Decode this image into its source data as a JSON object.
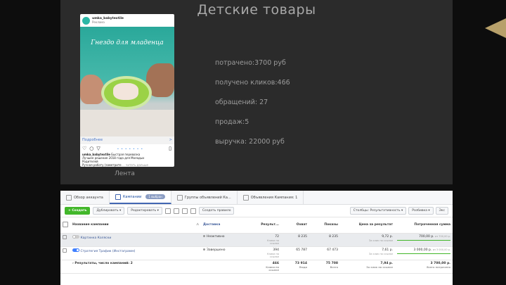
{
  "slide": {
    "title": "Детские товары",
    "caption": "Лента",
    "stats": [
      "потрачено:3700 руб",
      "получено кликов:466",
      "обращений: 27",
      "продаж:5",
      "выручка: 22000 руб"
    ]
  },
  "post": {
    "username": "umka_babytextile",
    "sponsored": "Реклама",
    "banner_text": "Гнездо для младенца",
    "more_label": "Подробнее",
    "more_arrow": ">",
    "dots": "• • • • • • •",
    "caption_user": "umka_babytextile",
    "caption_text": "Быстрая перевозка",
    "caption_line2": "Лучшее решение 2018 года для Молодых",
    "caption_line3": "Родителей",
    "caption_line4": "Ручная работу (заметрите",
    "caption_more": "... читать дальше",
    "icons": {
      "like": "heart-icon",
      "comment": "comment-icon",
      "share": "share-icon",
      "save": "bookmark-icon"
    }
  },
  "ads": {
    "tabs": [
      {
        "label": "Обзор аккаунта",
        "icon": "grid-icon"
      },
      {
        "label": "Кампании",
        "icon": "folder-icon",
        "badge": "1 выбран"
      },
      {
        "label": "Группы объявлений Ка...",
        "icon": "layers-icon"
      },
      {
        "label": "Объявления Кампания: 1",
        "icon": "ad-icon"
      }
    ],
    "toolbar": {
      "create": "+ Создать",
      "duplicate": "Дублировать ▾",
      "edit": "Редактировать ▾",
      "rule": "Создать правило",
      "columns": "Столбцы: Результативность ▾",
      "breakdown": "Разбивка ▾",
      "export": "Экс"
    },
    "columns": [
      "",
      "Название кампании",
      "⚠",
      "Доставка",
      "Результ...",
      "Охват",
      "Показы",
      "Цена за результат",
      "Потраченная сумма"
    ],
    "rows": [
      {
        "name": "Картинка Коляски",
        "delivery": "Неактивно",
        "results": "72",
        "results_sub": "Клики по ссылке",
        "reach": "8 235",
        "impressions": "8 235",
        "cpr": "9,72 р.",
        "cpr_sub": "За клик по ссылке",
        "spent": "700,00 р.",
        "spent_sub": "из 700,00 р.",
        "on": false,
        "selected": true
      },
      {
        "name": "Стратегия Трафик (Инстаграмм)",
        "delivery": "Завершено",
        "results": "394",
        "results_sub": "Клики по ссылке",
        "reach": "65 787",
        "impressions": "67 473",
        "cpr": "7,61 р.",
        "cpr_sub": "За клик по ссылке",
        "spent": "3 000,00 р.",
        "spent_sub": "из 3 000,00 р.",
        "on": true,
        "selected": false
      }
    ],
    "total": {
      "label": "› Результаты, число кампаний: 2",
      "results": "466",
      "results_sub": "Клики по ссылке",
      "reach": "73 914",
      "reach_sub": "Люди",
      "impressions": "75 708",
      "impressions_sub": "Всего",
      "cpr": "7,94 р.",
      "cpr_sub": "За клик по ссылке",
      "spent": "3 700,00 р.",
      "spent_sub": "Всего потрачено"
    }
  }
}
